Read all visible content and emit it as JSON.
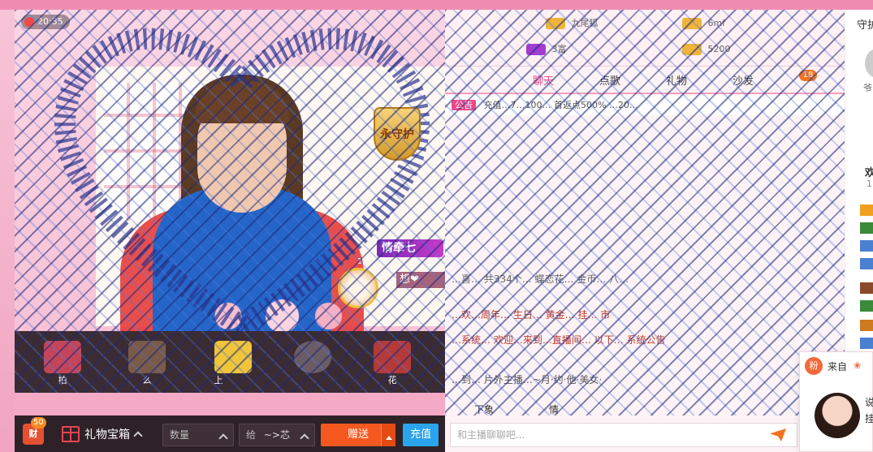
{
  "video": {
    "timer_text": "20:35",
    "guard_badge_text": "永守护",
    "guard_name": "情牵七",
    "guard_level": "1",
    "guard_sub_text": "想❤"
  },
  "gift_strip": {
    "items": [
      {
        "label": "拍"
      },
      {
        "label": "么"
      },
      {
        "label": "上"
      },
      {
        "label": ""
      },
      {
        "label": "花"
      }
    ]
  },
  "toolbar": {
    "wealth_label": "财",
    "wealth_count": "50",
    "giftbox_label": "礼物宝箱",
    "quantity_placeholder": "数量",
    "give_to_label": "给",
    "give_to_value": "~>芯",
    "send_label": "赠送",
    "recharge_label": "充值"
  },
  "chat": {
    "ranklist": [
      {
        "text": "九尾狐"
      },
      {
        "text": "6mf"
      },
      {
        "text": "5200"
      },
      {
        "text": "3富"
      }
    ],
    "tabs": [
      {
        "label": "聊天"
      },
      {
        "label": "点歌"
      },
      {
        "label": "礼物"
      },
      {
        "label": "沙发"
      }
    ],
    "tab_count": "18",
    "notice_tag": "公告",
    "notice_text": "充值…7…100… 首返点500% …20…",
    "messages": [
      {
        "text": "…喜… 共334个… 蝶恋花… 金币… 八…"
      },
      {
        "text": "…欢…周年… 生日… 黄金… 挂… 市"
      },
      {
        "text": "…系统… 欢迎…来到…直播间… 以下… 系统公告"
      },
      {
        "text": "…到… 片外主播…~月·约·他·美女·"
      }
    ],
    "bottom_tab_left": "下象",
    "bottom_tab_mid": "情",
    "input_placeholder": "和主播聊聊吧..."
  },
  "right_panel": {
    "title": "守护",
    "name": "爷",
    "section_title": "欢",
    "section_count": "1"
  },
  "popup": {
    "fan_label": "粉",
    "from_text": "来自",
    "side_text_1": "说",
    "side_text_2": "挂"
  },
  "colors": {
    "accent_pink": "#f0488a",
    "send_orange": "#f5591f",
    "recharge_blue": "#2aa4ec",
    "toolbar_bg": "#2e2228"
  }
}
